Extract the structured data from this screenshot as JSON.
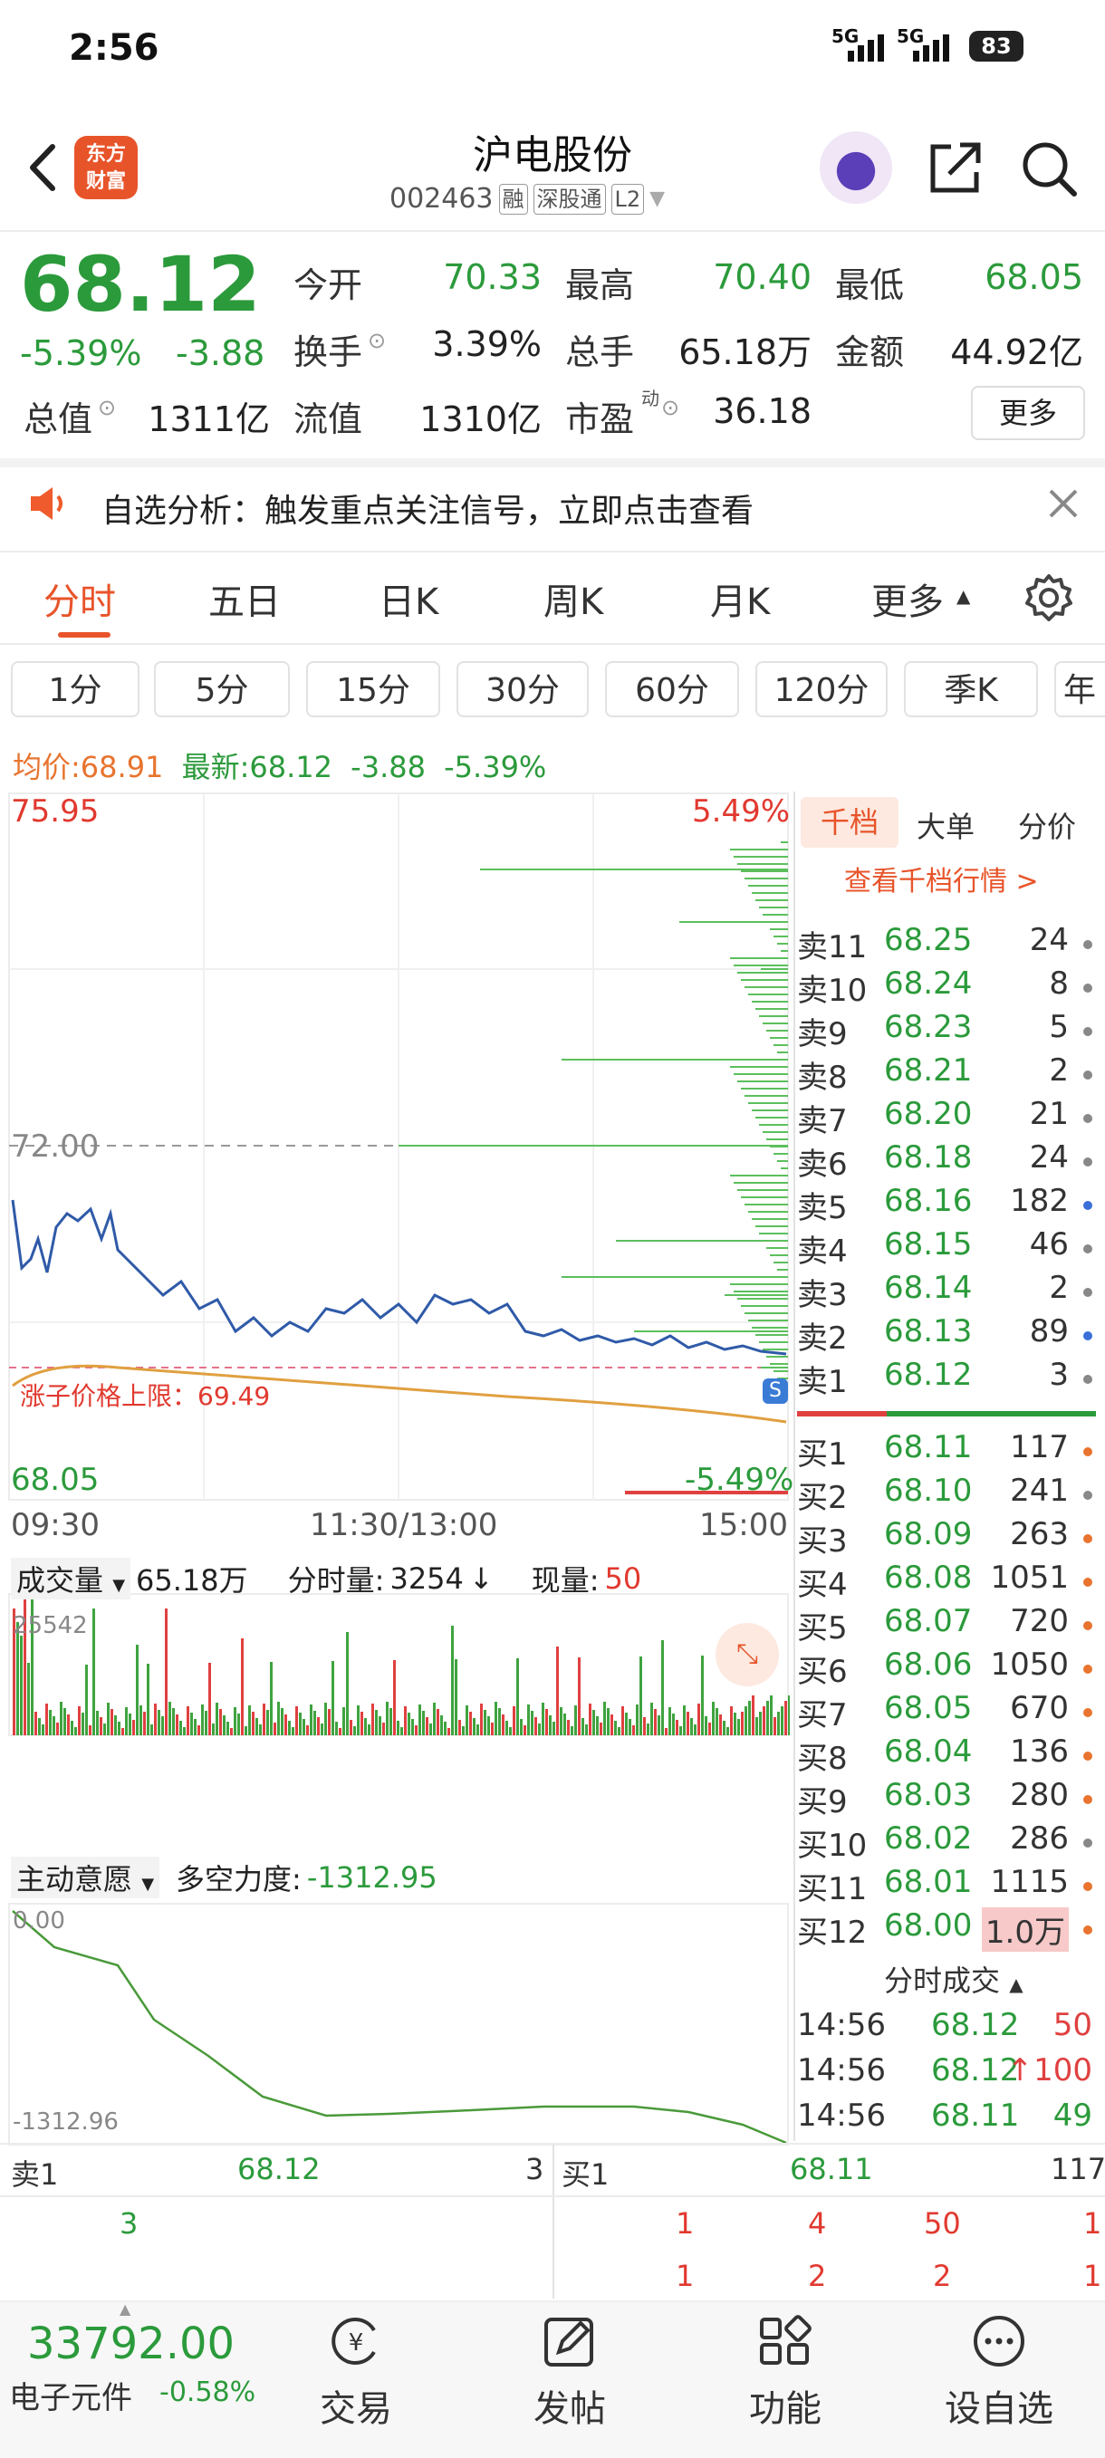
{
  "status_bar": {
    "time": "2:56",
    "net1": "5G",
    "net2": "5G",
    "battery": "83"
  },
  "header": {
    "logo_line1": "东方",
    "logo_line2": "财富",
    "stock_name": "沪电股份",
    "stock_code": "002463",
    "tags": [
      "融",
      "深股通",
      "L2"
    ]
  },
  "quote": {
    "price": "68.12",
    "change_pct": "-5.39%",
    "change_amt": "-3.88",
    "fields": [
      {
        "label": "今开",
        "value": "70.33",
        "color": "#2b9a3b"
      },
      {
        "label": "最高",
        "value": "70.40",
        "color": "#2b9a3b"
      },
      {
        "label": "最低",
        "value": "68.05",
        "color": "#2b9a3b"
      },
      {
        "label": "换手",
        "value": "3.39%",
        "color": "#222222"
      },
      {
        "label": "总手",
        "value": "65.18万",
        "color": "#222222"
      },
      {
        "label": "金额",
        "value": "44.92亿",
        "color": "#222222"
      },
      {
        "label": "总值",
        "value": "1311亿",
        "color": "#222222"
      },
      {
        "label": "流值",
        "value": "1310亿",
        "color": "#222222"
      },
      {
        "label": "市盈",
        "value": "36.18",
        "color": "#222222"
      }
    ],
    "pe_superscript": "动",
    "more": "更多"
  },
  "notice": {
    "text": "自选分析：触发重点关注信号，立即点击查看"
  },
  "tabs": [
    "分时",
    "五日",
    "日K",
    "周K",
    "月K",
    "更多"
  ],
  "periods": [
    "1分",
    "5分",
    "15分",
    "30分",
    "60分",
    "120分",
    "季K",
    "年"
  ],
  "avg_row": {
    "avg_label": "均价:",
    "avg_value": "68.91",
    "latest_label": "最新:",
    "latest_value": "68.12",
    "chg": "-3.88",
    "pct": "-5.39%"
  },
  "chart": {
    "y_top": "75.95",
    "y_mid": "72.00",
    "y_bottom": "68.05",
    "pct_top": "5.49%",
    "pct_bottom": "-5.49%",
    "limit_label": "涨子价格上限：69.49",
    "time_start": "09:30",
    "time_mid": "11:30/13:00",
    "time_end": "15:00",
    "s_badge": "S"
  },
  "volume": {
    "label": "成交量",
    "total": "65.18万",
    "tick_label": "分时量:",
    "tick_value": "3254",
    "now_label": "现量:",
    "now_value": "50",
    "max": "25542"
  },
  "indicator": {
    "label": "主动意愿",
    "power_label": "多空力度:",
    "power_value": "-1312.95",
    "top": "0.00",
    "bottom": "-1312.96"
  },
  "orderbook": {
    "tabs": [
      "千档",
      "大单",
      "分价"
    ],
    "view_all": "查看千档行情 >",
    "asks": [
      {
        "name": "卖11",
        "price": "68.25",
        "vol": "24",
        "dot": "#888888"
      },
      {
        "name": "卖10",
        "price": "68.24",
        "vol": "8",
        "dot": "#888888"
      },
      {
        "name": "卖9",
        "price": "68.23",
        "vol": "5",
        "dot": "#888888"
      },
      {
        "name": "卖8",
        "price": "68.21",
        "vol": "2",
        "dot": "#888888"
      },
      {
        "name": "卖7",
        "price": "68.20",
        "vol": "21",
        "dot": "#888888"
      },
      {
        "name": "卖6",
        "price": "68.18",
        "vol": "24",
        "dot": "#888888"
      },
      {
        "name": "卖5",
        "price": "68.16",
        "vol": "182",
        "dot": "#3a6fd8"
      },
      {
        "name": "卖4",
        "price": "68.15",
        "vol": "46",
        "dot": "#888888"
      },
      {
        "name": "卖3",
        "price": "68.14",
        "vol": "2",
        "dot": "#888888"
      },
      {
        "name": "卖2",
        "price": "68.13",
        "vol": "89",
        "dot": "#3a6fd8"
      },
      {
        "name": "卖1",
        "price": "68.12",
        "vol": "3",
        "dot": "#888888"
      }
    ],
    "bids": [
      {
        "name": "买1",
        "price": "68.11",
        "vol": "117",
        "dot": "#e8742f"
      },
      {
        "name": "买2",
        "price": "68.10",
        "vol": "241",
        "dot": "#888888"
      },
      {
        "name": "买3",
        "price": "68.09",
        "vol": "263",
        "dot": "#e8742f"
      },
      {
        "name": "买4",
        "price": "68.08",
        "vol": "1051",
        "dot": "#e8742f"
      },
      {
        "name": "买5",
        "price": "68.07",
        "vol": "720",
        "dot": "#e8742f"
      },
      {
        "name": "买6",
        "price": "68.06",
        "vol": "1050",
        "dot": "#e8742f"
      },
      {
        "name": "买7",
        "price": "68.05",
        "vol": "670",
        "dot": "#e8742f"
      },
      {
        "name": "买8",
        "price": "68.04",
        "vol": "136",
        "dot": "#e8742f"
      },
      {
        "name": "买9",
        "price": "68.03",
        "vol": "280",
        "dot": "#e8742f"
      },
      {
        "name": "买10",
        "price": "68.02",
        "vol": "286",
        "dot": "#888888"
      },
      {
        "name": "买11",
        "price": "68.01",
        "vol": "1115",
        "dot": "#e8742f"
      },
      {
        "name": "买12",
        "price": "68.00",
        "vol": "1.0万",
        "dot": "#e8742f"
      }
    ],
    "ticks_title": "分时成交",
    "ticks": [
      {
        "time": "14:56",
        "price": "68.12",
        "vol": "50",
        "arrow": ""
      },
      {
        "time": "14:56",
        "price": "68.12",
        "vol": "100",
        "arrow": "↑"
      },
      {
        "time": "14:56",
        "price": "68.11",
        "vol": "49",
        "arrow": ""
      }
    ]
  },
  "level_row": {
    "ask_label": "卖1",
    "ask_price": "68.12",
    "ask_vol": "3",
    "bid_label": "买1",
    "bid_price": "68.11",
    "bid_vol": "117",
    "ask_queue": [
      "3"
    ],
    "bid_queue_1": [
      "1",
      "4",
      "50",
      "1"
    ],
    "bid_queue_2": [
      "1",
      "2",
      "2",
      "1"
    ]
  },
  "bottom": {
    "index_value": "33792.00",
    "index_name": "电子元件",
    "index_pct": "-0.58%",
    "nav": [
      "交易",
      "发帖",
      "功能",
      "设自选"
    ]
  }
}
